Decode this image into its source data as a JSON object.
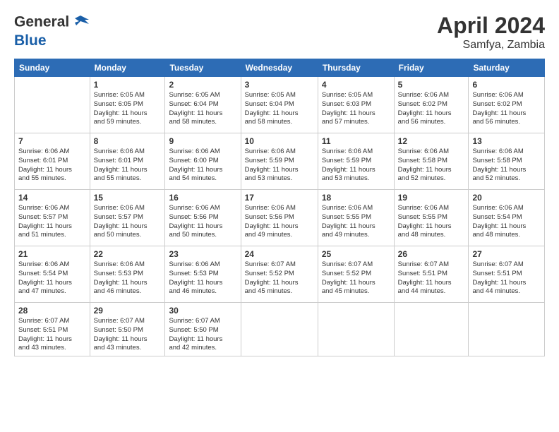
{
  "header": {
    "logo_general": "General",
    "logo_blue": "Blue",
    "month_year": "April 2024",
    "location": "Samfya, Zambia"
  },
  "columns": [
    "Sunday",
    "Monday",
    "Tuesday",
    "Wednesday",
    "Thursday",
    "Friday",
    "Saturday"
  ],
  "weeks": [
    [
      {
        "day": "",
        "info": ""
      },
      {
        "day": "1",
        "info": "Sunrise: 6:05 AM\nSunset: 6:05 PM\nDaylight: 11 hours\nand 59 minutes."
      },
      {
        "day": "2",
        "info": "Sunrise: 6:05 AM\nSunset: 6:04 PM\nDaylight: 11 hours\nand 58 minutes."
      },
      {
        "day": "3",
        "info": "Sunrise: 6:05 AM\nSunset: 6:04 PM\nDaylight: 11 hours\nand 58 minutes."
      },
      {
        "day": "4",
        "info": "Sunrise: 6:05 AM\nSunset: 6:03 PM\nDaylight: 11 hours\nand 57 minutes."
      },
      {
        "day": "5",
        "info": "Sunrise: 6:06 AM\nSunset: 6:02 PM\nDaylight: 11 hours\nand 56 minutes."
      },
      {
        "day": "6",
        "info": "Sunrise: 6:06 AM\nSunset: 6:02 PM\nDaylight: 11 hours\nand 56 minutes."
      }
    ],
    [
      {
        "day": "7",
        "info": "Sunrise: 6:06 AM\nSunset: 6:01 PM\nDaylight: 11 hours\nand 55 minutes."
      },
      {
        "day": "8",
        "info": "Sunrise: 6:06 AM\nSunset: 6:01 PM\nDaylight: 11 hours\nand 55 minutes."
      },
      {
        "day": "9",
        "info": "Sunrise: 6:06 AM\nSunset: 6:00 PM\nDaylight: 11 hours\nand 54 minutes."
      },
      {
        "day": "10",
        "info": "Sunrise: 6:06 AM\nSunset: 5:59 PM\nDaylight: 11 hours\nand 53 minutes."
      },
      {
        "day": "11",
        "info": "Sunrise: 6:06 AM\nSunset: 5:59 PM\nDaylight: 11 hours\nand 53 minutes."
      },
      {
        "day": "12",
        "info": "Sunrise: 6:06 AM\nSunset: 5:58 PM\nDaylight: 11 hours\nand 52 minutes."
      },
      {
        "day": "13",
        "info": "Sunrise: 6:06 AM\nSunset: 5:58 PM\nDaylight: 11 hours\nand 52 minutes."
      }
    ],
    [
      {
        "day": "14",
        "info": "Sunrise: 6:06 AM\nSunset: 5:57 PM\nDaylight: 11 hours\nand 51 minutes."
      },
      {
        "day": "15",
        "info": "Sunrise: 6:06 AM\nSunset: 5:57 PM\nDaylight: 11 hours\nand 50 minutes."
      },
      {
        "day": "16",
        "info": "Sunrise: 6:06 AM\nSunset: 5:56 PM\nDaylight: 11 hours\nand 50 minutes."
      },
      {
        "day": "17",
        "info": "Sunrise: 6:06 AM\nSunset: 5:56 PM\nDaylight: 11 hours\nand 49 minutes."
      },
      {
        "day": "18",
        "info": "Sunrise: 6:06 AM\nSunset: 5:55 PM\nDaylight: 11 hours\nand 49 minutes."
      },
      {
        "day": "19",
        "info": "Sunrise: 6:06 AM\nSunset: 5:55 PM\nDaylight: 11 hours\nand 48 minutes."
      },
      {
        "day": "20",
        "info": "Sunrise: 6:06 AM\nSunset: 5:54 PM\nDaylight: 11 hours\nand 48 minutes."
      }
    ],
    [
      {
        "day": "21",
        "info": "Sunrise: 6:06 AM\nSunset: 5:54 PM\nDaylight: 11 hours\nand 47 minutes."
      },
      {
        "day": "22",
        "info": "Sunrise: 6:06 AM\nSunset: 5:53 PM\nDaylight: 11 hours\nand 46 minutes."
      },
      {
        "day": "23",
        "info": "Sunrise: 6:06 AM\nSunset: 5:53 PM\nDaylight: 11 hours\nand 46 minutes."
      },
      {
        "day": "24",
        "info": "Sunrise: 6:07 AM\nSunset: 5:52 PM\nDaylight: 11 hours\nand 45 minutes."
      },
      {
        "day": "25",
        "info": "Sunrise: 6:07 AM\nSunset: 5:52 PM\nDaylight: 11 hours\nand 45 minutes."
      },
      {
        "day": "26",
        "info": "Sunrise: 6:07 AM\nSunset: 5:51 PM\nDaylight: 11 hours\nand 44 minutes."
      },
      {
        "day": "27",
        "info": "Sunrise: 6:07 AM\nSunset: 5:51 PM\nDaylight: 11 hours\nand 44 minutes."
      }
    ],
    [
      {
        "day": "28",
        "info": "Sunrise: 6:07 AM\nSunset: 5:51 PM\nDaylight: 11 hours\nand 43 minutes."
      },
      {
        "day": "29",
        "info": "Sunrise: 6:07 AM\nSunset: 5:50 PM\nDaylight: 11 hours\nand 43 minutes."
      },
      {
        "day": "30",
        "info": "Sunrise: 6:07 AM\nSunset: 5:50 PM\nDaylight: 11 hours\nand 42 minutes."
      },
      {
        "day": "",
        "info": ""
      },
      {
        "day": "",
        "info": ""
      },
      {
        "day": "",
        "info": ""
      },
      {
        "day": "",
        "info": ""
      }
    ]
  ]
}
